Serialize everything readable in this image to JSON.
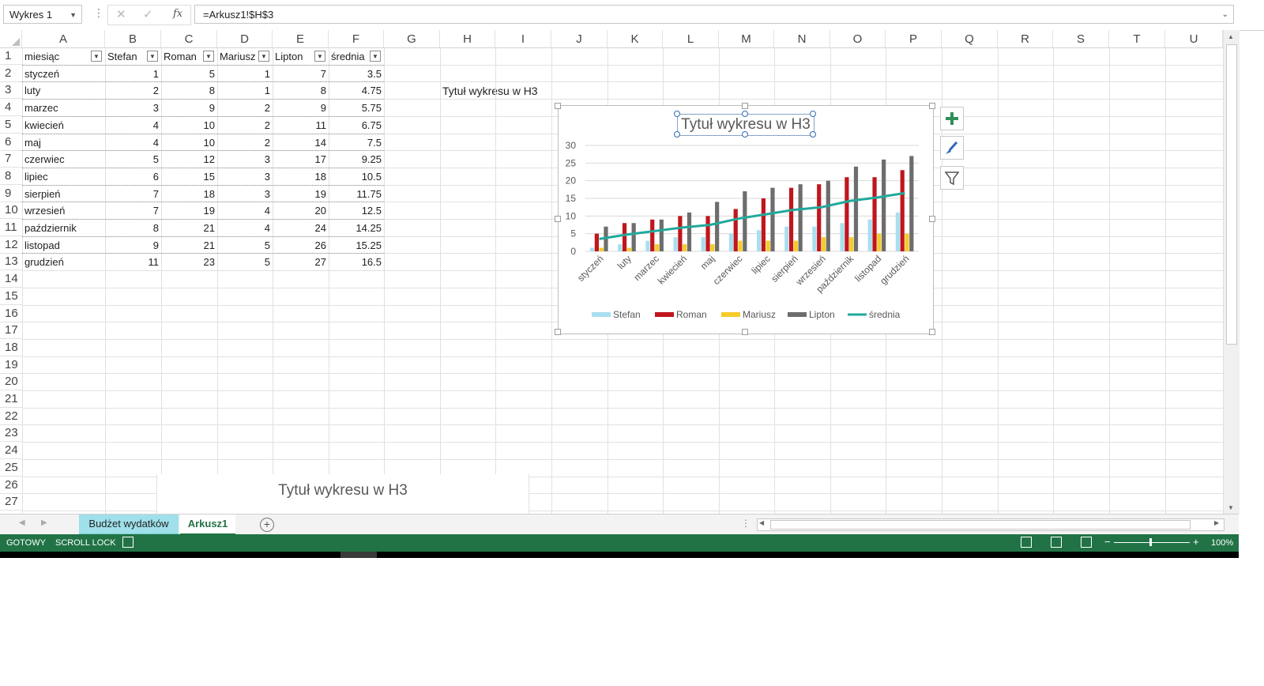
{
  "formula_bar": {
    "name_box": "Wykres 1",
    "formula": "=Arkusz1!$H$3",
    "fx": "fx"
  },
  "columns": [
    "A",
    "B",
    "C",
    "D",
    "E",
    "F",
    "G",
    "H",
    "I",
    "J",
    "K",
    "L",
    "M",
    "N",
    "O",
    "P",
    "Q",
    "R",
    "S",
    "T",
    "U"
  ],
  "rows": [
    "1",
    "2",
    "3",
    "4",
    "5",
    "6",
    "7",
    "8",
    "9",
    "10",
    "11",
    "12",
    "13",
    "14",
    "15",
    "16",
    "17",
    "18",
    "19",
    "20",
    "21",
    "22",
    "23",
    "24",
    "25",
    "26",
    "27"
  ],
  "table": {
    "headers": [
      "miesiąc",
      "Stefan",
      "Roman",
      "Mariusz",
      "Lipton",
      "średnia"
    ],
    "data": [
      [
        "styczeń",
        "1",
        "5",
        "1",
        "7",
        "3.5"
      ],
      [
        "luty",
        "2",
        "8",
        "1",
        "8",
        "4.75"
      ],
      [
        "marzec",
        "3",
        "9",
        "2",
        "9",
        "5.75"
      ],
      [
        "kwiecień",
        "4",
        "10",
        "2",
        "11",
        "6.75"
      ],
      [
        "maj",
        "4",
        "10",
        "2",
        "14",
        "7.5"
      ],
      [
        "czerwiec",
        "5",
        "12",
        "3",
        "17",
        "9.25"
      ],
      [
        "lipiec",
        "6",
        "15",
        "3",
        "18",
        "10.5"
      ],
      [
        "sierpień",
        "7",
        "18",
        "3",
        "19",
        "11.75"
      ],
      [
        "wrzesień",
        "7",
        "19",
        "4",
        "20",
        "12.5"
      ],
      [
        "październik",
        "8",
        "21",
        "4",
        "24",
        "14.25"
      ],
      [
        "listopad",
        "9",
        "21",
        "5",
        "26",
        "15.25"
      ],
      [
        "grudzień",
        "11",
        "23",
        "5",
        "27",
        "16.5"
      ]
    ]
  },
  "h3_cell": "Tytuł wykresu w H3",
  "chart_data": {
    "type": "bar",
    "title": "Tytuł wykresu w H3",
    "categories": [
      "styczeń",
      "luty",
      "marzec",
      "kwiecień",
      "maj",
      "czerwiec",
      "lipiec",
      "sierpień",
      "wrzesień",
      "październik",
      "listopad",
      "grudzień"
    ],
    "series": [
      {
        "name": "Stefan",
        "type": "bar",
        "color": "#a9dff0",
        "values": [
          1,
          2,
          3,
          4,
          4,
          5,
          6,
          7,
          7,
          8,
          9,
          11
        ]
      },
      {
        "name": "Roman",
        "type": "bar",
        "color": "#c0161d",
        "values": [
          5,
          8,
          9,
          10,
          10,
          12,
          15,
          18,
          19,
          21,
          21,
          23
        ]
      },
      {
        "name": "Mariusz",
        "type": "bar",
        "color": "#f5cc2a",
        "values": [
          1,
          1,
          2,
          2,
          2,
          3,
          3,
          3,
          4,
          4,
          5,
          5
        ]
      },
      {
        "name": "Lipton",
        "type": "bar",
        "color": "#6d6d6d",
        "values": [
          7,
          8,
          9,
          11,
          14,
          17,
          18,
          19,
          20,
          24,
          26,
          27
        ]
      },
      {
        "name": "średnia",
        "type": "line",
        "color": "#21a99c",
        "values": [
          3.5,
          4.75,
          5.75,
          6.75,
          7.5,
          9.25,
          10.5,
          11.75,
          12.5,
          14.25,
          15.25,
          16.5
        ]
      }
    ],
    "yticks": [
      "0",
      "5",
      "10",
      "15",
      "20",
      "25",
      "30"
    ],
    "ylim": [
      0,
      30
    ],
    "legend": "bottom",
    "grid": true
  },
  "chart2_title": "Tytuł wykresu w H3",
  "tabs": [
    "Budżet wydatków",
    "Arkusz1"
  ],
  "status": {
    "ready": "GOTOWY",
    "scroll_lock": "SCROLL LOCK",
    "zoom": "100%"
  },
  "colors": {
    "excel_green": "#217346",
    "tab_active": "#217346",
    "tab_colored": "#9fe0ea"
  }
}
